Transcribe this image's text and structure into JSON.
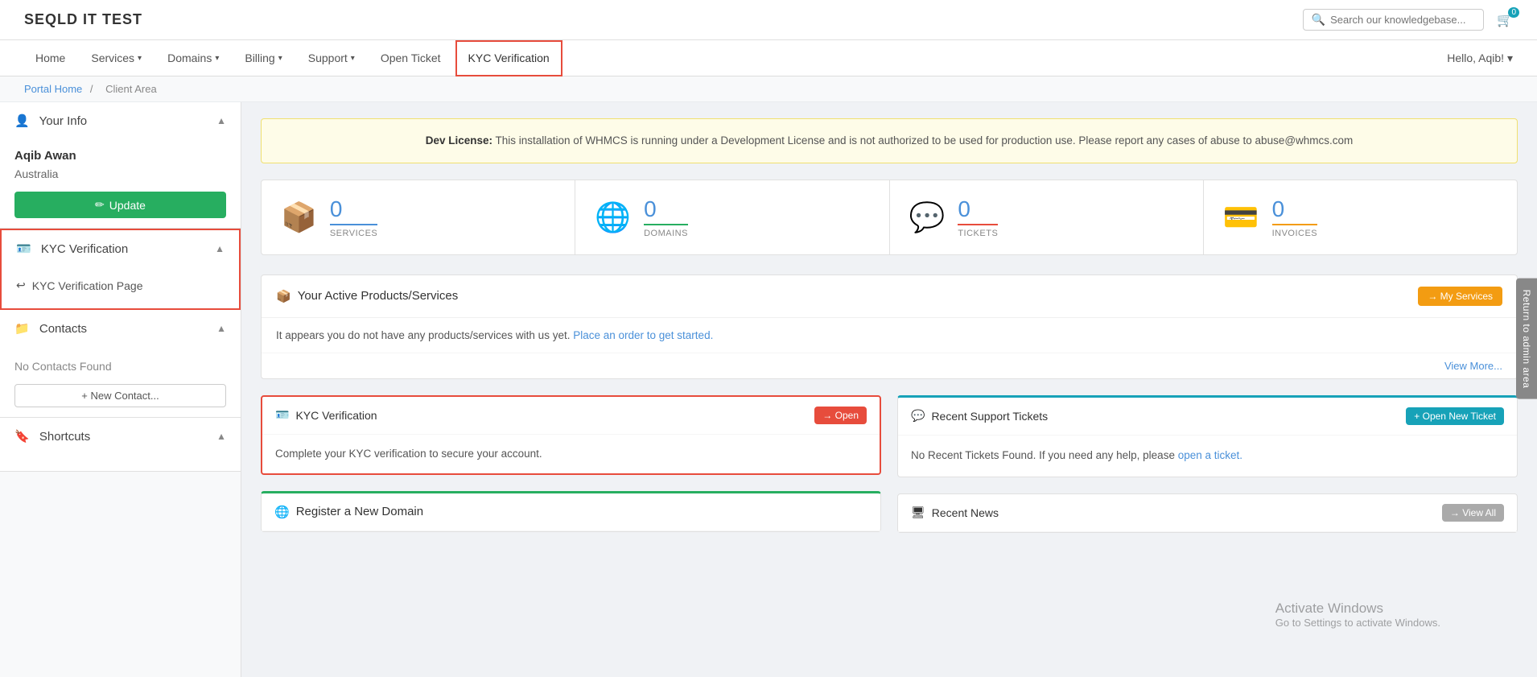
{
  "site": {
    "logo": "SEQLD IT TEST"
  },
  "topbar": {
    "search_placeholder": "Search our knowledgebase...",
    "cart_count": "0",
    "hello": "Hello, Aqib!",
    "return_admin": "Return to admin area"
  },
  "nav": {
    "items": [
      {
        "label": "Home",
        "arrow": false
      },
      {
        "label": "Services",
        "arrow": true
      },
      {
        "label": "Domains",
        "arrow": true
      },
      {
        "label": "Billing",
        "arrow": true
      },
      {
        "label": "Support",
        "arrow": true
      },
      {
        "label": "Open Ticket",
        "arrow": false
      },
      {
        "label": "KYC Verification",
        "arrow": false,
        "active": true
      }
    ]
  },
  "breadcrumb": {
    "portal_home": "Portal Home",
    "separator": "/",
    "current": "Client Area"
  },
  "sidebar": {
    "your_info": {
      "title": "Your Info",
      "user_name": "Aqib Awan",
      "country": "Australia",
      "update_btn": "Update",
      "update_icon": "✏"
    },
    "kyc": {
      "title": "KYC Verification",
      "sub_item": "KYC Verification Page",
      "sub_icon": "↩"
    },
    "contacts": {
      "title": "Contacts",
      "no_contacts": "No Contacts Found",
      "new_contact_btn": "+ New Contact..."
    },
    "shortcuts": {
      "title": "Shortcuts"
    }
  },
  "dev_notice": {
    "bold": "Dev License:",
    "text": " This installation of WHMCS is running under a Development License and is not authorized to be used for production use. Please report any cases of abuse to abuse@whmcs.com"
  },
  "stats": [
    {
      "number": "0",
      "label": "SERVICES",
      "color": "blue",
      "icon": "📦"
    },
    {
      "number": "0",
      "label": "DOMAINS",
      "color": "green",
      "icon": "🌐"
    },
    {
      "number": "0",
      "label": "TICKETS",
      "color": "red",
      "icon": "💬"
    },
    {
      "number": "0",
      "label": "INVOICES",
      "color": "orange",
      "icon": "💳"
    }
  ],
  "active_products": {
    "title": "Your Active Products/Services",
    "title_icon": "📦",
    "my_services_btn": "→ My Services",
    "body_text": "It appears you do not have any products/services with us yet.",
    "link_text": "Place an order to get started.",
    "view_more": "View More..."
  },
  "kyc_card": {
    "title": "KYC Verification",
    "title_icon": "🪪",
    "open_btn": "→ Open",
    "body": "Complete your KYC verification to secure your account."
  },
  "support_tickets": {
    "title": "Recent Support Tickets",
    "title_icon": "💬",
    "open_ticket_btn": "+ Open New Ticket",
    "body_text": "No Recent Tickets Found. If you need any help, please",
    "link_text": "open a ticket."
  },
  "register_domain": {
    "title": "Register a New Domain",
    "icon": "🌐"
  },
  "recent_news": {
    "title": "Recent News",
    "icon": "🖥",
    "view_all_btn": "→ View All"
  },
  "activate_windows": {
    "line1": "Activate Windows",
    "line2": "Go to Settings to activate Windows."
  }
}
